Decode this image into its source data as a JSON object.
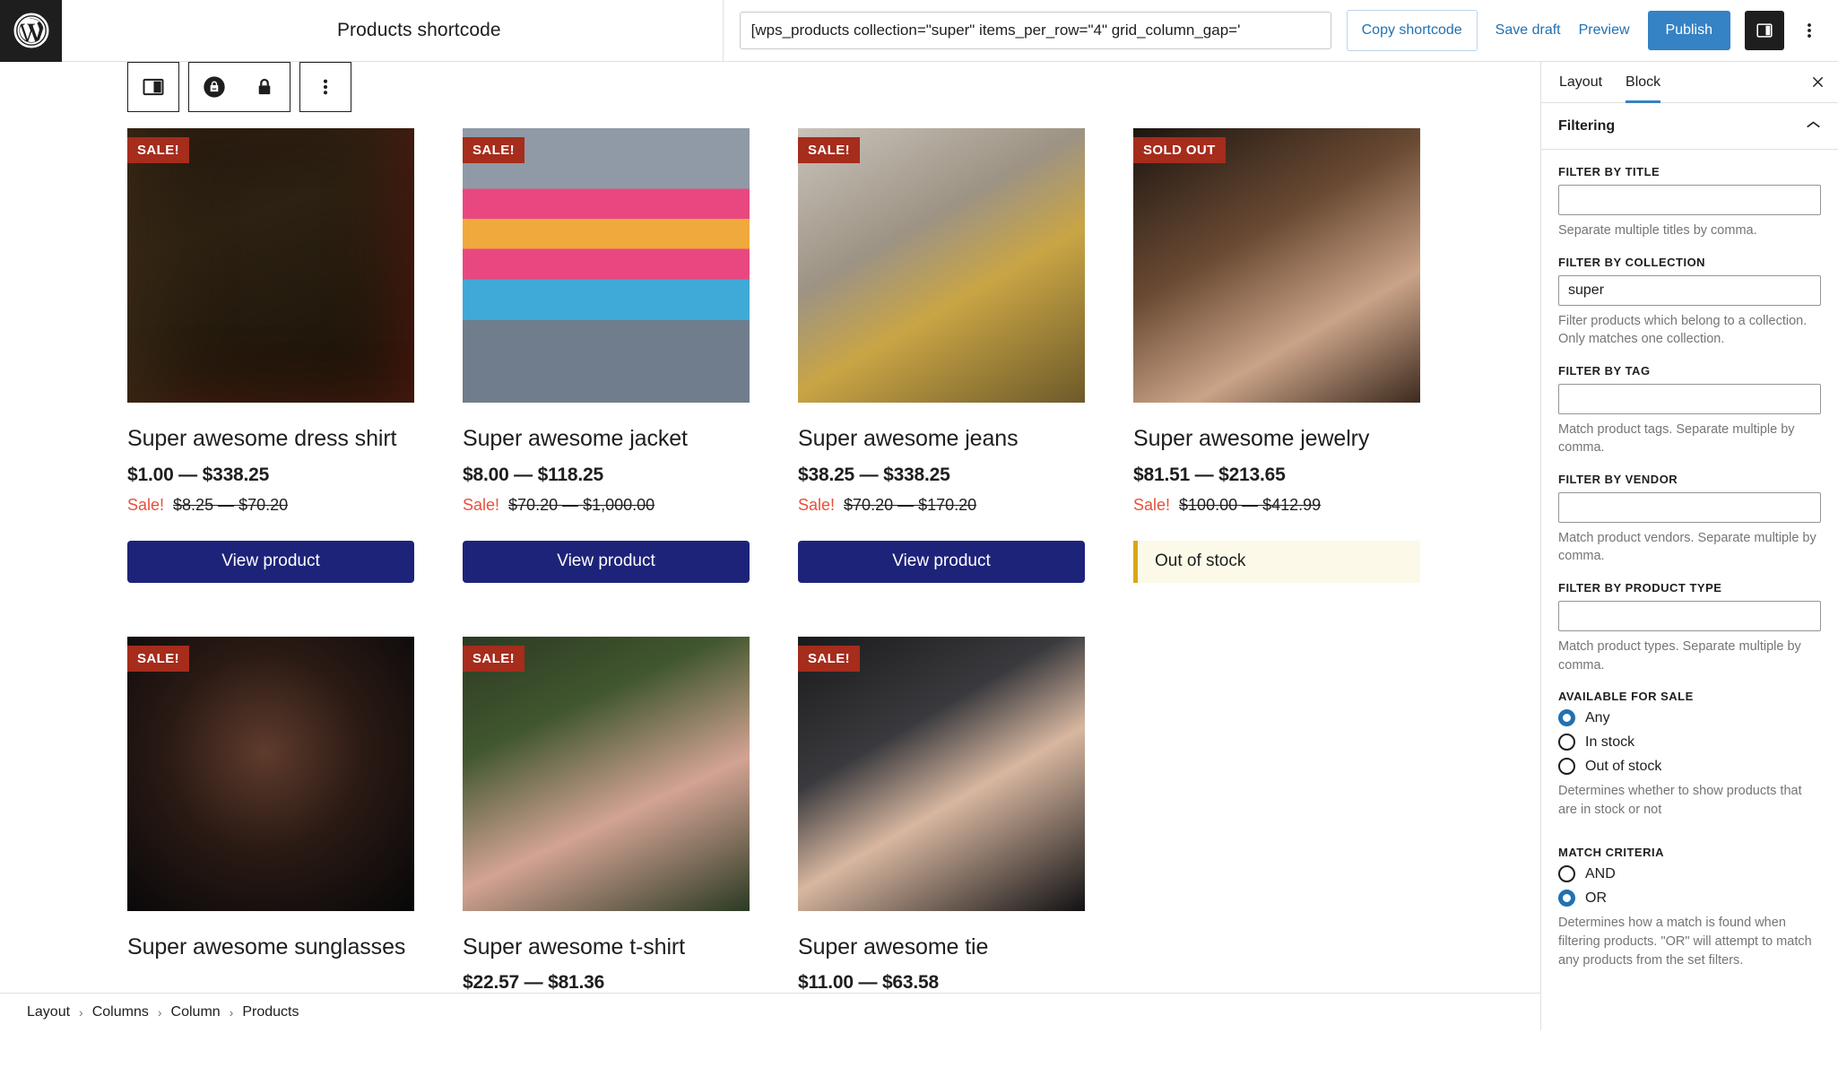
{
  "topbar": {
    "logo_icon": "wordpress-logo-icon",
    "document_title": "Products shortcode",
    "shortcode_value": "[wps_products collection=\"super\" items_per_row=\"4\" grid_column_gap='",
    "copy_shortcode_label": "Copy shortcode",
    "save_draft_label": "Save draft",
    "preview_label": "Preview",
    "publish_label": "Publish",
    "settings_icon": "sidebar-toggle-icon",
    "more_icon": "three-dots-vertical-icon",
    "accent_blue": "#3582c4",
    "link_blue": "#2271b1"
  },
  "block_toolbar": {
    "columns_icon": "columns-block-icon",
    "product_icon": "shopping-bag-icon",
    "lock_icon": "lock-icon",
    "options_icon": "three-dots-vertical-icon"
  },
  "products": [
    {
      "badge": "SALE!",
      "badge_type": "sale",
      "title": "Super awesome dress shirt",
      "price": "$1.00 — $338.25",
      "sale_word": "Sale!",
      "sale_price": "$8.25 — $70.20",
      "action": "View product",
      "action_type": "button",
      "photo": "man-in-blue-dress-shirt"
    },
    {
      "badge": "SALE!",
      "badge_type": "sale",
      "title": "Super awesome jacket",
      "price": "$8.00 — $118.25",
      "sale_word": "Sale!",
      "sale_price": "$70.20 — $1,000.00",
      "action": "View product",
      "action_type": "button",
      "photo": "woman-in-blue-jacket-colorful-wall"
    },
    {
      "badge": "SALE!",
      "badge_type": "sale",
      "title": "Super awesome jeans",
      "price": "$38.25 — $338.25",
      "sale_word": "Sale!",
      "sale_price": "$70.20 — $170.20",
      "action": "View product",
      "action_type": "button",
      "photo": "man-in-patterned-shirt-glasses"
    },
    {
      "badge": "SOLD OUT",
      "badge_type": "soldout",
      "title": "Super awesome jewelry",
      "price": "$81.51 — $213.65",
      "sale_word": "Sale!",
      "sale_price": "$100.00 — $412.99",
      "action": "Out of stock",
      "action_type": "notice",
      "photo": "woman-with-sunglasses-on-head"
    },
    {
      "badge": "SALE!",
      "badge_type": "sale",
      "title": "Super awesome sunglasses",
      "price": "",
      "sale_word": "",
      "sale_price": "",
      "action": "",
      "action_type": "none",
      "photo": "woman-with-reflective-sunglasses-dark"
    },
    {
      "badge": "SALE!",
      "badge_type": "sale",
      "title": "Super awesome t-shirt",
      "price": "$22.57 — $81.36",
      "sale_word": "",
      "sale_price": "",
      "action": "",
      "action_type": "none",
      "photo": "man-in-pink-tee-palm-leaves"
    },
    {
      "badge": "SALE!",
      "badge_type": "sale",
      "title": "Super awesome tie",
      "price": "$11.00 — $63.58",
      "sale_word": "",
      "sale_price": "",
      "action": "",
      "action_type": "none",
      "photo": "man-in-suit-with-red-tie"
    }
  ],
  "sidebar": {
    "tabs": [
      {
        "label": "Layout",
        "active": false
      },
      {
        "label": "Block",
        "active": true
      }
    ],
    "close_icon": "close-icon",
    "panel": {
      "title": "Filtering",
      "chevron_icon": "chevron-up-icon"
    },
    "fields": [
      {
        "label": "Filter by title",
        "value": "",
        "help": "Separate multiple titles by comma."
      },
      {
        "label": "Filter by collection",
        "value": "super",
        "help": "Filter products which belong to a collection. Only matches one collection."
      },
      {
        "label": "Filter by tag",
        "value": "",
        "help": "Match product tags. Separate multiple by comma."
      },
      {
        "label": "Filter by vendor",
        "value": "",
        "help": "Match product vendors. Separate multiple by comma."
      },
      {
        "label": "Filter by product type",
        "value": "",
        "help": "Match product types. Separate multiple by comma."
      }
    ],
    "available_for_sale": {
      "label": "Available for sale",
      "options": [
        {
          "label": "Any",
          "selected": true
        },
        {
          "label": "In stock",
          "selected": false
        },
        {
          "label": "Out of stock",
          "selected": false
        }
      ],
      "help": "Determines whether to show products that are in stock or not"
    },
    "match_criteria": {
      "label": "Match criteria",
      "options": [
        {
          "label": "AND",
          "selected": false
        },
        {
          "label": "OR",
          "selected": true
        }
      ],
      "help": "Determines how a match is found when filtering products. \"OR\" will attempt to match any products from the set filters."
    }
  },
  "breadcrumb": {
    "items": [
      "Layout",
      "Columns",
      "Column",
      "Products"
    ],
    "separator": "›"
  }
}
